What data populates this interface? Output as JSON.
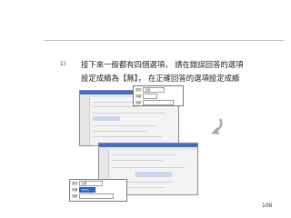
{
  "slide": {
    "item_number": "1)",
    "line1": "接下來一般都有四個選項，  請在錯誤回答的選項",
    "line2": "設定成績為【無】，  在正確回答的選項設定成績",
    "page_number": "106"
  },
  "popup_top": {
    "row1_label": "選項",
    "row1_value": "正確",
    "row2_label": "成績",
    "row3_label": "回饋"
  },
  "popup_bottom": {
    "row1_label": "選項",
    "row1_value": "正確",
    "row2_label": "成績",
    "row2_value": "100%",
    "row3_label": "回饋"
  },
  "icons": {
    "arrow": "curved-down-arrow-icon"
  }
}
